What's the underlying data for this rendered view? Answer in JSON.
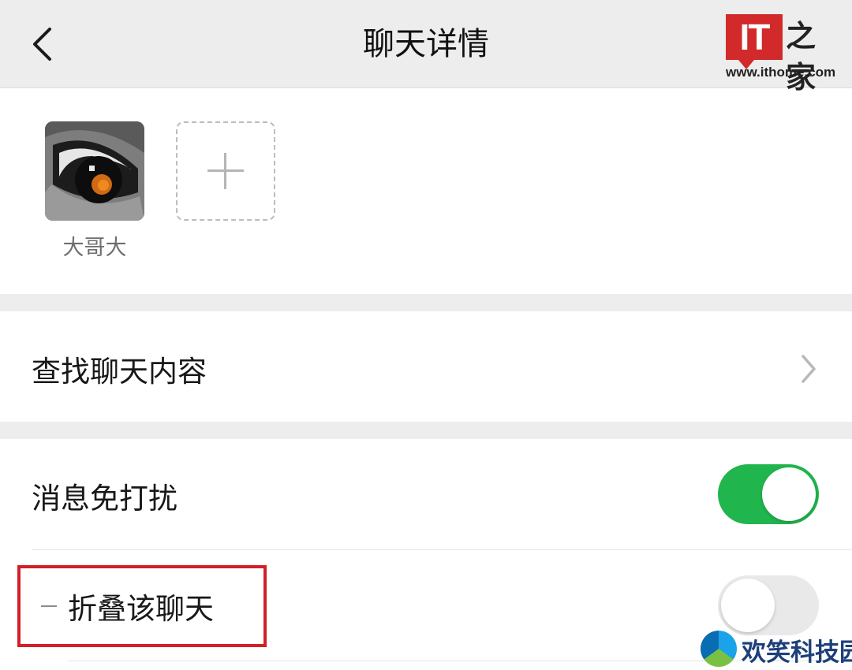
{
  "header": {
    "title": "聊天详情"
  },
  "watermark_top": {
    "brand_mark": "IT",
    "brand_cn": "之家",
    "url": "www.ithome.com"
  },
  "members": [
    {
      "name": "大哥大"
    }
  ],
  "add_member_icon": "plus-icon",
  "rows": {
    "search_history": "查找聊天内容",
    "mute_notifications": "消息免打扰",
    "fold_chat": "折叠该聊天"
  },
  "toggles": {
    "mute_notifications": true,
    "fold_chat": false
  },
  "watermark_bottom": {
    "text": "欢笑科技园"
  },
  "colors": {
    "header_bg": "#ededed",
    "toggle_on": "#21b54d",
    "highlight_box": "#d21f2a",
    "it_red": "#d22a2a"
  }
}
